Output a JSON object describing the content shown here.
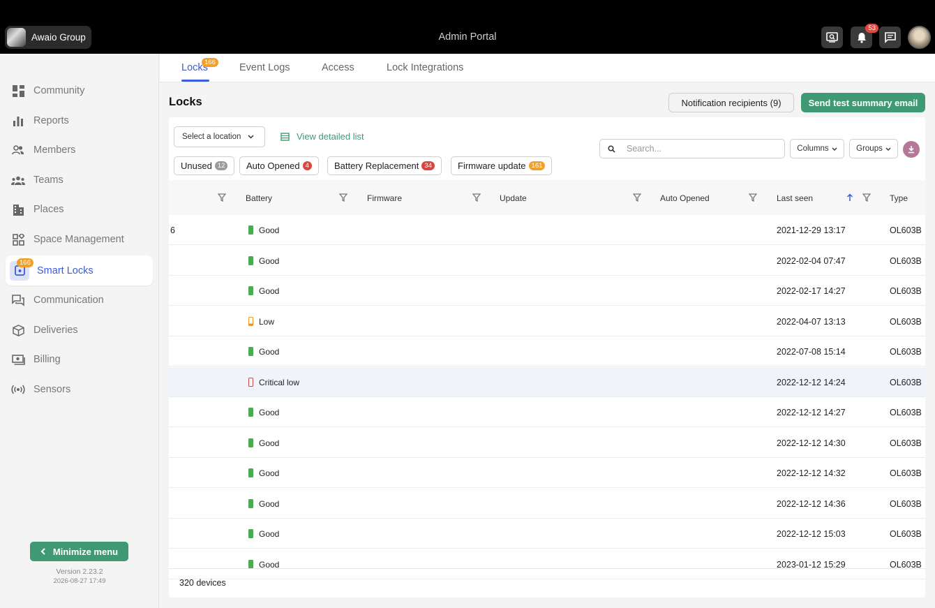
{
  "header": {
    "org_name": "Awaio Group",
    "title": "Admin Portal",
    "notifications_count": "53"
  },
  "sidebar": {
    "items": [
      {
        "label": "Community",
        "icon": "dashboard-icon"
      },
      {
        "label": "Reports",
        "icon": "bar-chart-icon"
      },
      {
        "label": "Members",
        "icon": "people-icon"
      },
      {
        "label": "Teams",
        "icon": "groups-icon"
      },
      {
        "label": "Places",
        "icon": "building-icon"
      },
      {
        "label": "Space Management",
        "icon": "widgets-icon"
      },
      {
        "label": "Smart Locks",
        "icon": "lock-icon",
        "badge": "166",
        "active": true
      },
      {
        "label": "Communication",
        "icon": "forum-icon"
      },
      {
        "label": "Deliveries",
        "icon": "package-icon"
      },
      {
        "label": "Billing",
        "icon": "money-icon"
      },
      {
        "label": "Sensors",
        "icon": "sensors-icon"
      }
    ],
    "minimize_label": "Minimize menu",
    "version": "Version 2.23.2",
    "version_date": "2026-08-27 17:49"
  },
  "tabs": {
    "items": [
      {
        "label": "Locks",
        "badge": "166",
        "active": true
      },
      {
        "label": "Event Logs"
      },
      {
        "label": "Access"
      },
      {
        "label": "Lock Integrations"
      }
    ]
  },
  "page": {
    "title": "Locks",
    "notification_recipients_label": "Notification recipients (9)",
    "send_test_label": "Send test summary email"
  },
  "toolbar": {
    "location_select": "Select a location",
    "view_list_label": "View detailed list",
    "search_placeholder": "Search...",
    "columns_label": "Columns",
    "groups_label": "Groups",
    "chips": [
      {
        "label": "Unused",
        "count": "12",
        "color": "#9a9a9a"
      },
      {
        "label": "Auto Opened",
        "count": "4",
        "color": "#d6483f"
      },
      {
        "label": "Battery Replacement",
        "count": "34",
        "color": "#d6483f"
      },
      {
        "label": "Firmware update",
        "count": "161",
        "color": "#f0a02b"
      }
    ]
  },
  "table": {
    "columns": [
      "Battery",
      "Firmware",
      "Update",
      "Auto Opened",
      "Last seen",
      "Type"
    ],
    "rows": [
      {
        "first": "6",
        "battery": "Good",
        "level": "good",
        "last_seen": "2021-12-29 13:17",
        "type": "OL603B"
      },
      {
        "first": "",
        "battery": "Good",
        "level": "good",
        "last_seen": "2022-02-04 07:47",
        "type": "OL603B"
      },
      {
        "first": "",
        "battery": "Good",
        "level": "good",
        "last_seen": "2022-02-17 14:27",
        "type": "OL603B"
      },
      {
        "first": "",
        "battery": "Low",
        "level": "low",
        "last_seen": "2022-04-07 13:13",
        "type": "OL603B"
      },
      {
        "first": "",
        "battery": "Good",
        "level": "good",
        "last_seen": "2022-07-08 15:14",
        "type": "OL603B"
      },
      {
        "first": "",
        "battery": "Critical low",
        "level": "crit",
        "last_seen": "2022-12-12 14:24",
        "type": "OL603B"
      },
      {
        "first": "",
        "battery": "Good",
        "level": "good",
        "last_seen": "2022-12-12 14:27",
        "type": "OL603B"
      },
      {
        "first": "",
        "battery": "Good",
        "level": "good",
        "last_seen": "2022-12-12 14:30",
        "type": "OL603B"
      },
      {
        "first": "",
        "battery": "Good",
        "level": "good",
        "last_seen": "2022-12-12 14:32",
        "type": "OL603B"
      },
      {
        "first": "",
        "battery": "Good",
        "level": "good",
        "last_seen": "2022-12-12 14:36",
        "type": "OL603B"
      },
      {
        "first": "",
        "battery": "Good",
        "level": "good",
        "last_seen": "2022-12-12 15:03",
        "type": "OL603B"
      },
      {
        "first": "",
        "battery": "Good",
        "level": "good",
        "last_seen": "2023-01-12 15:29",
        "type": "OL603B"
      }
    ],
    "footer_count": "320 devices"
  },
  "colors": {
    "accent": "#3a5cd8",
    "primary_green": "#3f9a73",
    "badge_orange": "#f0a02b",
    "badge_red": "#e0483f"
  }
}
